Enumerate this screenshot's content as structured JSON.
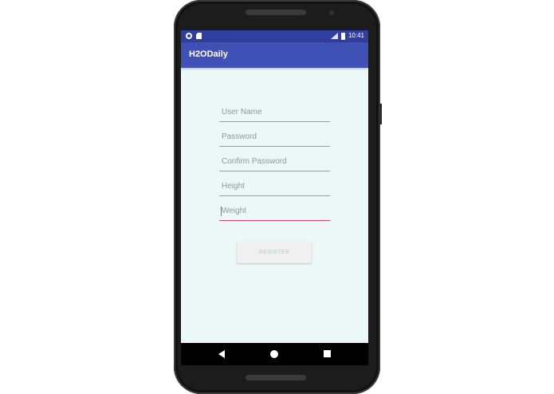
{
  "status_bar": {
    "time": "10:41"
  },
  "app_bar": {
    "title": "H2ODaily"
  },
  "form": {
    "fields": [
      {
        "placeholder": "User Name"
      },
      {
        "placeholder": "Password"
      },
      {
        "placeholder": "Confirm Password"
      },
      {
        "placeholder": "Height"
      },
      {
        "placeholder": "Weight"
      }
    ],
    "register_label": "REGISTER"
  },
  "colors": {
    "status_bar": "#303f9f",
    "app_bar": "#3f51b5",
    "screen_bg": "#ecf7f8",
    "focus_accent": "#e0406b"
  },
  "icons": {
    "status_left": [
      "sync-icon",
      "sd-card-icon"
    ],
    "status_right": [
      "signal-icon",
      "battery-icon"
    ],
    "nav": [
      "back-icon",
      "home-icon",
      "recent-apps-icon"
    ]
  }
}
